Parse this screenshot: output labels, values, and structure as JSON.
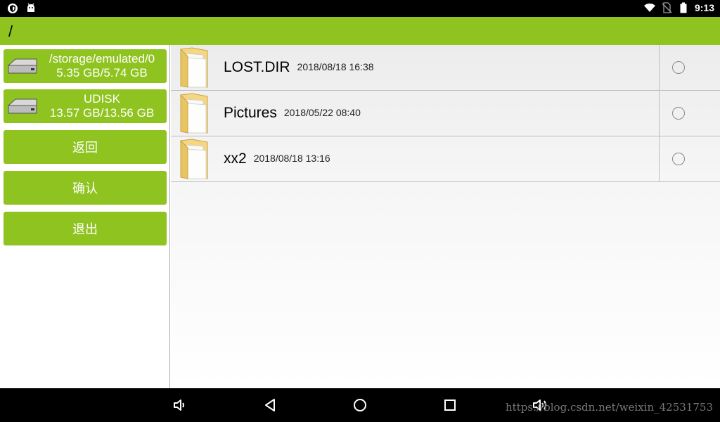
{
  "status_bar": {
    "time": "9:13",
    "left_icons": [
      "shield-icon",
      "android-icon"
    ],
    "right_icons": [
      "wifi-icon",
      "no-sim-icon",
      "battery-icon"
    ]
  },
  "title_bar": {
    "path": "/"
  },
  "sidebar": {
    "drives": [
      {
        "name": "/storage/emulated/0",
        "usage": "5.35 GB/5.74 GB",
        "icon": "hard-drive-icon"
      },
      {
        "name": "UDISK",
        "usage": "13.57 GB/13.56 GB",
        "icon": "hard-drive-icon"
      }
    ],
    "buttons": {
      "back": "返回",
      "confirm": "确认",
      "exit": "退出"
    }
  },
  "files": [
    {
      "name": "LOST.DIR",
      "date": "2018/08/18 16:38",
      "icon": "folder-icon",
      "selected": false
    },
    {
      "name": "Pictures",
      "date": "2018/05/22 08:40",
      "icon": "folder-icon",
      "selected": false
    },
    {
      "name": "xx2",
      "date": "2018/08/18 13:16",
      "icon": "folder-icon",
      "selected": false
    }
  ],
  "nav_bar": {
    "buttons": [
      "volume-down-icon",
      "back-triangle-icon",
      "home-circle-icon",
      "recents-square-icon",
      "volume-up-icon"
    ],
    "watermark": "https://blog.csdn.net/weixin_42531753"
  },
  "colors": {
    "accent": "#8fc31f",
    "bars": "#000000"
  }
}
